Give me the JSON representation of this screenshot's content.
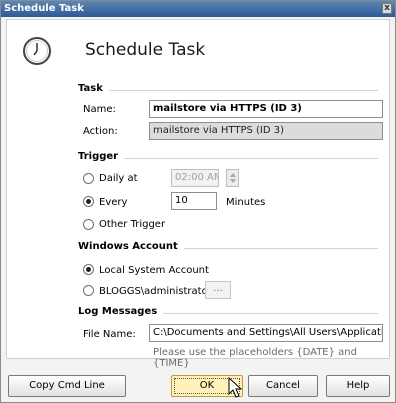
{
  "window": {
    "title": "Schedule Task",
    "close_glyph": "x"
  },
  "header": {
    "title": "Schedule Task",
    "icon": "clock-icon"
  },
  "task": {
    "section_label": "Task",
    "name_label": "Name:",
    "name_value": "mailstore via HTTPS (ID 3)",
    "action_label": "Action:",
    "action_value": "mailstore via HTTPS (ID 3)"
  },
  "trigger": {
    "section_label": "Trigger",
    "daily_label": "Daily at",
    "daily_time": "02:00 AM",
    "every_label": "Every",
    "every_value": "10",
    "every_unit": "Minutes",
    "other_label": "Other Trigger",
    "selected": "every"
  },
  "account": {
    "section_label": "Windows Account",
    "local_label": "Local System Account",
    "user_label": "BLOGGS\\administrator",
    "browse_label": "...",
    "selected": "local"
  },
  "log": {
    "section_label": "Log Messages",
    "file_label": "File Name:",
    "file_value": "C:\\Documents and Settings\\All Users\\Application Data\\",
    "hint": "Please use the placeholders {DATE} and {TIME}"
  },
  "buttons": {
    "copy_cmd": "Copy Cmd Line",
    "ok": "OK",
    "cancel": "Cancel",
    "help": "Help"
  },
  "colors": {
    "titlebar": "#2d5a92",
    "ok_button": "#fff1b8"
  }
}
